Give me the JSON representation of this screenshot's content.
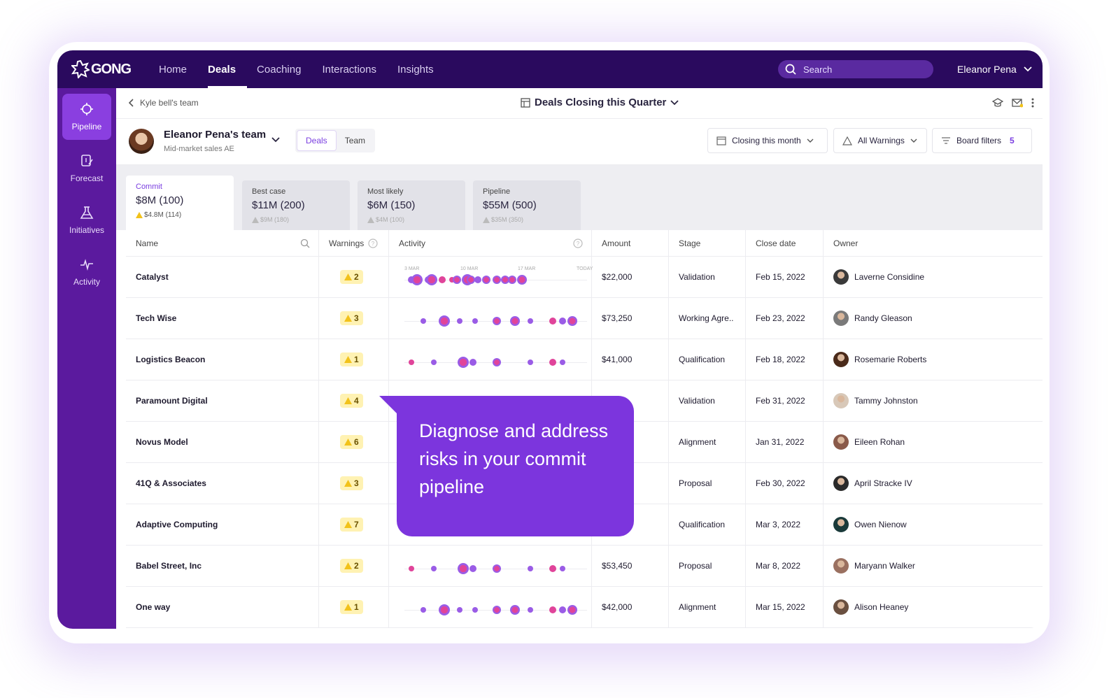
{
  "app": {
    "logo_text": "GONG"
  },
  "nav": {
    "items": [
      {
        "label": "Home"
      },
      {
        "label": "Deals"
      },
      {
        "label": "Coaching"
      },
      {
        "label": "Interactions"
      },
      {
        "label": "Insights"
      }
    ],
    "active": "Deals"
  },
  "search": {
    "placeholder": "Search"
  },
  "user": {
    "name": "Eleanor Pena"
  },
  "sidebar": {
    "items": [
      {
        "label": "Pipeline",
        "icon": "crosshair-icon"
      },
      {
        "label": "Forecast",
        "icon": "forecast-icon"
      },
      {
        "label": "Initiatives",
        "icon": "flask-icon"
      },
      {
        "label": "Activity",
        "icon": "pulse-icon"
      }
    ]
  },
  "breadcrumb": {
    "back_label": "Kyle bell's team"
  },
  "view": {
    "title": "Deals Closing this Quarter"
  },
  "team": {
    "name": "Eleanor Pena's team",
    "subtitle": "Mid-market sales AE",
    "tabs": [
      "Deals",
      "Team"
    ]
  },
  "filters": {
    "closing": "Closing this month",
    "warnings": "All Warnings",
    "board": "Board filters",
    "board_count": "5"
  },
  "cards": [
    {
      "label": "Commit",
      "value": "$8M (100)",
      "sub": "$4.8M (114)"
    },
    {
      "label": "Best case",
      "value": "$11M (200)",
      "sub": "$9M (180)"
    },
    {
      "label": "Most likely",
      "value": "$6M (150)",
      "sub": "$4M (100)"
    },
    {
      "label": "Pipeline",
      "value": "$55M (500)",
      "sub": "$35M (350)"
    }
  ],
  "table": {
    "headers": {
      "name": "Name",
      "warnings": "Warnings",
      "activity": "Activity",
      "amount": "Amount",
      "stage": "Stage",
      "close": "Close date",
      "owner": "Owner"
    },
    "activity_dates": [
      "3 MAR",
      "10 MAR",
      "17 MAR",
      "TODAY"
    ],
    "rows": [
      {
        "name": "Catalyst",
        "warnings": "2",
        "amount": "$22,000",
        "stage": "Validation",
        "close": "Feb 15, 2022",
        "owner": "Laverne Considine"
      },
      {
        "name": "Tech Wise",
        "warnings": "3",
        "amount": "$73,250",
        "stage": "Working Agre..",
        "close": "Feb 23, 2022",
        "owner": "Randy Gleason"
      },
      {
        "name": "Logistics Beacon",
        "warnings": "1",
        "amount": "$41,000",
        "stage": "Qualification",
        "close": "Feb 18, 2022",
        "owner": "Rosemarie Roberts"
      },
      {
        "name": "Paramount Digital",
        "warnings": "4",
        "amount": "",
        "stage": "Validation",
        "close": "Feb 31, 2022",
        "owner": "Tammy Johnston"
      },
      {
        "name": "Novus Model",
        "warnings": "6",
        "amount": "",
        "stage": "Alignment",
        "close": "Jan 31, 2022",
        "owner": "Eileen Rohan"
      },
      {
        "name": "41Q & Associates",
        "warnings": "3",
        "amount": "",
        "stage": "Proposal",
        "close": "Feb 30, 2022",
        "owner": "April Stracke IV"
      },
      {
        "name": "Adaptive Computing",
        "warnings": "7",
        "amount": "",
        "stage": "Qualification",
        "close": "Mar 3, 2022",
        "owner": "Owen Nienow"
      },
      {
        "name": "Babel Street, Inc",
        "warnings": "2",
        "amount": "$53,450",
        "stage": "Proposal",
        "close": "Mar 8, 2022",
        "owner": "Maryann Walker"
      },
      {
        "name": "One way",
        "warnings": "1",
        "amount": "$42,000",
        "stage": "Alignment",
        "close": "Mar 15, 2022",
        "owner": "Alison Heaney"
      }
    ]
  },
  "callout": {
    "text": "Diagnose and address risks in your commit pipeline"
  },
  "colors": {
    "topbar": "#2a0a5e",
    "sidebar": "#5b1a9e",
    "accent": "#7c35dd",
    "dot_pink": "#e0449a",
    "dot_purple": "#9a5ce6"
  }
}
